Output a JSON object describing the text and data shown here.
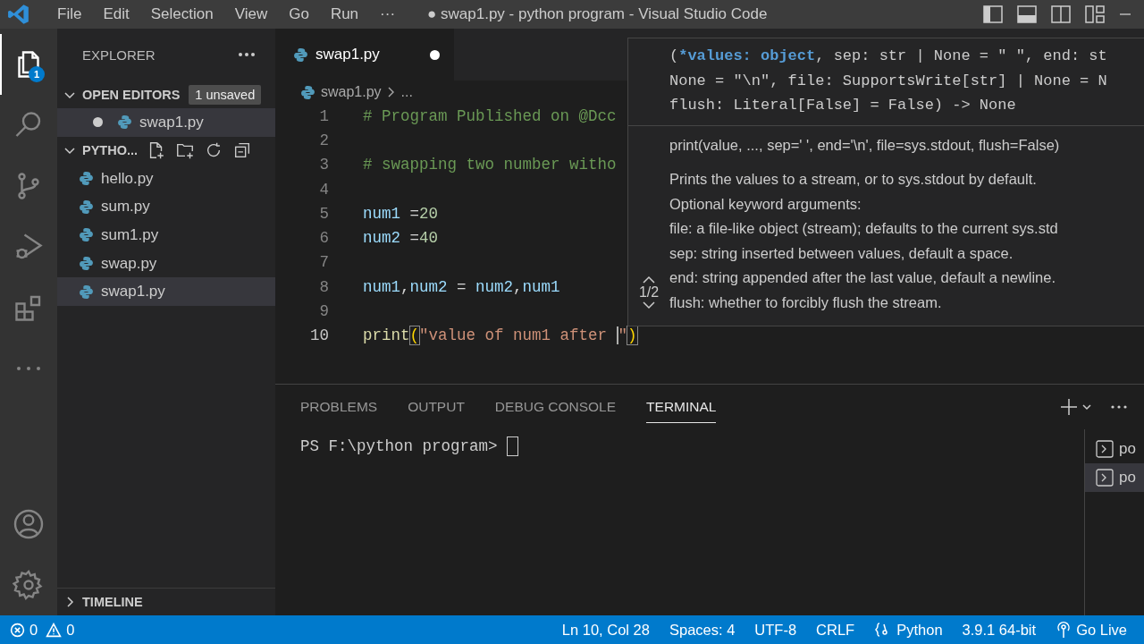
{
  "title_bar": {
    "menus": [
      "File",
      "Edit",
      "Selection",
      "View",
      "Go",
      "Run",
      "···"
    ],
    "title": "● swap1.py - python program - Visual Studio Code"
  },
  "activity_bar": [
    {
      "kind": "explorer",
      "selected": true,
      "badge": "1"
    },
    {
      "kind": "search",
      "selected": false
    },
    {
      "kind": "source_control",
      "selected": false
    },
    {
      "kind": "run_debug",
      "selected": false
    },
    {
      "kind": "extensions",
      "selected": false
    },
    {
      "kind": "more",
      "selected": false
    },
    {
      "kind": "accounts",
      "selected": false
    },
    {
      "kind": "settings",
      "selected": false
    }
  ],
  "sidebar": {
    "title": "EXPLORER",
    "open_editors": {
      "label": "OPEN EDITORS",
      "expanded": true,
      "badge": "1 unsaved",
      "items": [
        {
          "name": "swap1.py",
          "unsaved": true,
          "selected": true
        }
      ]
    },
    "folder": {
      "label": "PYTHO...",
      "expanded": true,
      "files": [
        {
          "name": "hello.py",
          "selected": false
        },
        {
          "name": "sum.py",
          "selected": false
        },
        {
          "name": "sum1.py",
          "selected": false
        },
        {
          "name": "swap.py",
          "selected": false
        },
        {
          "name": "swap1.py",
          "selected": true
        }
      ]
    },
    "timeline": {
      "label": "TIMELINE",
      "expanded": false
    }
  },
  "editor": {
    "tabs": [
      {
        "name": "swap1.py",
        "unsaved": true,
        "selected": true
      }
    ],
    "breadcrumb": [
      "swap1.py",
      "..."
    ],
    "lines": [
      {
        "number": "1",
        "current": false,
        "tokens": [
          {
            "text": "# Program Published on @Dcc",
            "kind": "comment"
          }
        ]
      },
      {
        "number": "2",
        "current": false
      },
      {
        "number": "3",
        "current": false,
        "tokens": [
          {
            "text": "# swapping two number witho",
            "kind": "comment"
          }
        ]
      },
      {
        "number": "4",
        "current": false
      },
      {
        "number": "5",
        "current": false,
        "tokens": [
          {
            "text": "num1",
            "kind": "variable"
          },
          {
            "text": " =",
            "kind": "operator"
          },
          {
            "text": "20",
            "kind": "number"
          }
        ]
      },
      {
        "number": "6",
        "current": false,
        "tokens": [
          {
            "text": "num2",
            "kind": "variable"
          },
          {
            "text": " =",
            "kind": "operator"
          },
          {
            "text": "40",
            "kind": "number"
          }
        ]
      },
      {
        "number": "7",
        "current": false
      },
      {
        "number": "8",
        "current": false,
        "tokens": [
          {
            "text": "num1",
            "kind": "variable"
          },
          {
            "text": ",",
            "kind": "operator"
          },
          {
            "text": "num2",
            "kind": "variable"
          },
          {
            "text": " = ",
            "kind": "operator"
          },
          {
            "text": "num2",
            "kind": "variable"
          },
          {
            "text": ",",
            "kind": "operator"
          },
          {
            "text": "num1",
            "kind": "variable"
          }
        ]
      },
      {
        "number": "9",
        "current": false
      },
      {
        "number": "10",
        "current": true,
        "tokens": [
          {
            "text": "print",
            "kind": "function"
          },
          {
            "text": "(",
            "kind": "bracket"
          },
          {
            "text": "\"value of num1 after ",
            "kind": "string"
          },
          {
            "text": "\"",
            "kind": "string",
            "cursor_before": true
          },
          {
            "text": ")",
            "kind": "bracket"
          }
        ]
      }
    ]
  },
  "hover": {
    "signature": [
      [
        {
          "text": "(",
          "kind": "plain"
        },
        {
          "text": "*values: object",
          "kind": "param"
        },
        {
          "text": ", sep: str | None = \" \", end: st",
          "kind": "plain"
        }
      ],
      [
        {
          "text": "None = \"\\n\", file: SupportsWrite[str] | None = N",
          "kind": "plain"
        }
      ],
      [
        {
          "text": "flush: Literal[False] = False) -> None",
          "kind": "plain"
        }
      ]
    ],
    "doc_title": "print(value, ..., sep=' ', end='\\n', file=sys.stdout, flush=False)",
    "doc": [
      "Prints the values to a stream, or to sys.stdout by default.",
      "Optional keyword arguments:",
      "file: a file-like object (stream); defaults to the current sys.std",
      "sep: string inserted between values, default a space.",
      "end: string appended after the last value, default a newline.",
      "flush: whether to forcibly flush the stream."
    ],
    "pager": "1/2"
  },
  "panel": {
    "tabs": [
      {
        "label": "PROBLEMS",
        "selected": false
      },
      {
        "label": "OUTPUT",
        "selected": false
      },
      {
        "label": "DEBUG CONSOLE",
        "selected": false
      },
      {
        "label": "TERMINAL",
        "selected": true
      }
    ],
    "prompt": "PS F:\\python program>",
    "terminals": [
      {
        "name": "po",
        "selected": false
      },
      {
        "name": "po",
        "selected": true
      }
    ]
  },
  "status_bar": {
    "errors": "0",
    "warnings": "0",
    "items": [
      {
        "text": "Ln 10, Col 28",
        "kind": "plain"
      },
      {
        "text": "Spaces: 4",
        "kind": "plain"
      },
      {
        "text": "UTF-8",
        "kind": "plain"
      },
      {
        "text": "CRLF",
        "kind": "plain"
      },
      {
        "text": "Python",
        "kind": "language"
      },
      {
        "text": "3.9.1 64-bit",
        "kind": "plain"
      },
      {
        "text": "Go Live",
        "kind": "live"
      }
    ]
  }
}
